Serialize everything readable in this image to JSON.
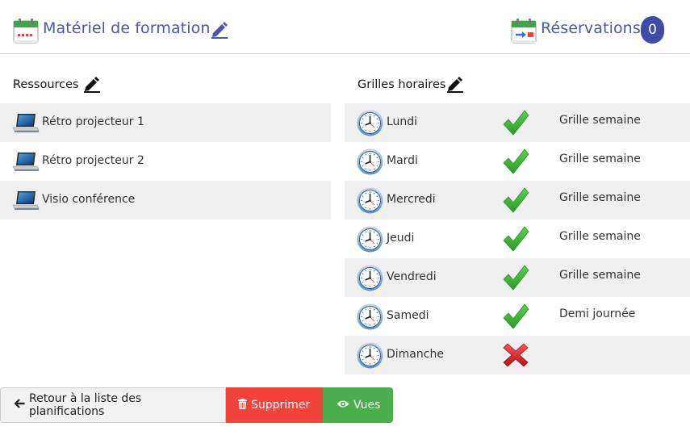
{
  "header": {
    "title": "Matériel de formation",
    "reservations_label": "Réservations",
    "reservations_count": "0"
  },
  "resources": {
    "label": "Ressources",
    "items": [
      {
        "label": "Rétro projecteur 1"
      },
      {
        "label": "Rétro projecteur 2"
      },
      {
        "label": "Visio conférence"
      }
    ]
  },
  "schedule": {
    "label": "Grilles horaires",
    "days": [
      {
        "day": "Lundi",
        "active": true,
        "grid": "Grille semaine"
      },
      {
        "day": "Mardi",
        "active": true,
        "grid": "Grille semaine"
      },
      {
        "day": "Mercredi",
        "active": true,
        "grid": "Grille semaine"
      },
      {
        "day": "Jeudi",
        "active": true,
        "grid": "Grille semaine"
      },
      {
        "day": "Vendredi",
        "active": true,
        "grid": "Grille semaine"
      },
      {
        "day": "Samedi",
        "active": true,
        "grid": "Demi journée"
      },
      {
        "day": "Dimanche",
        "active": false,
        "grid": ""
      }
    ]
  },
  "actions": {
    "back_label": "Retour à la liste des planifications",
    "delete_label": "Supprimer",
    "views_label": "Vues"
  },
  "colors": {
    "title": "#4d55a8",
    "badge": "#3f4ca7",
    "row_shade": "#efefef",
    "delete": "#f2433a",
    "views": "#49ae4b",
    "check": "#3ea935",
    "cross": "#d9201c"
  }
}
